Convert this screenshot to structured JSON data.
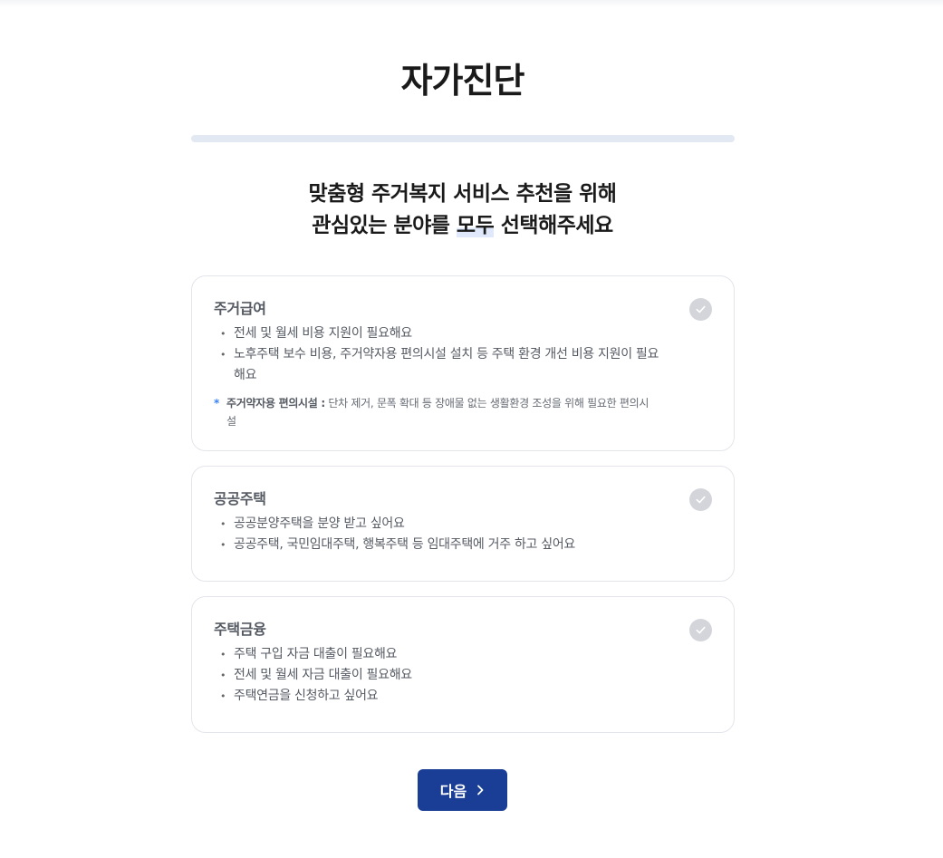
{
  "page": {
    "title": "자가진단",
    "heading_line1": "맞춤형 주거복지 서비스 추천을 위해",
    "heading_line2_pre": "관심있는 분야를 ",
    "heading_line2_highlight": "모두",
    "heading_line2_post": " 선택해주세요"
  },
  "cards": [
    {
      "title": "주거급여",
      "items": [
        "전세 및 월세 비용 지원이 필요해요",
        "노후주택 보수 비용, 주거약자용 편의시설 설치 등 주택 환경 개선 비용 지원이 필요해요"
      ],
      "note_star": "*",
      "note_term": "주거약자용 편의시설 :",
      "note_text": " 단차 제거, 문폭 확대 등 장애물 없는 생활환경 조성을 위해 필요한 편의시설"
    },
    {
      "title": "공공주택",
      "items": [
        "공공분양주택을 분양 받고 싶어요",
        "공공주택, 국민임대주택, 행복주택 등 임대주택에 거주 하고 싶어요"
      ]
    },
    {
      "title": "주택금융",
      "items": [
        "주택 구입 자금 대출이 필요해요",
        "전세 및 월세 자금 대출이 필요해요",
        "주택연금을 신청하고 싶어요"
      ]
    }
  ],
  "next_button": {
    "label": "다음",
    "icon": "chevron-right-icon"
  },
  "colors": {
    "primary": "#1a3e96",
    "check_unselected": "#d3d5da",
    "note_star": "#3b82f6",
    "card_border": "#e3e5ea"
  }
}
